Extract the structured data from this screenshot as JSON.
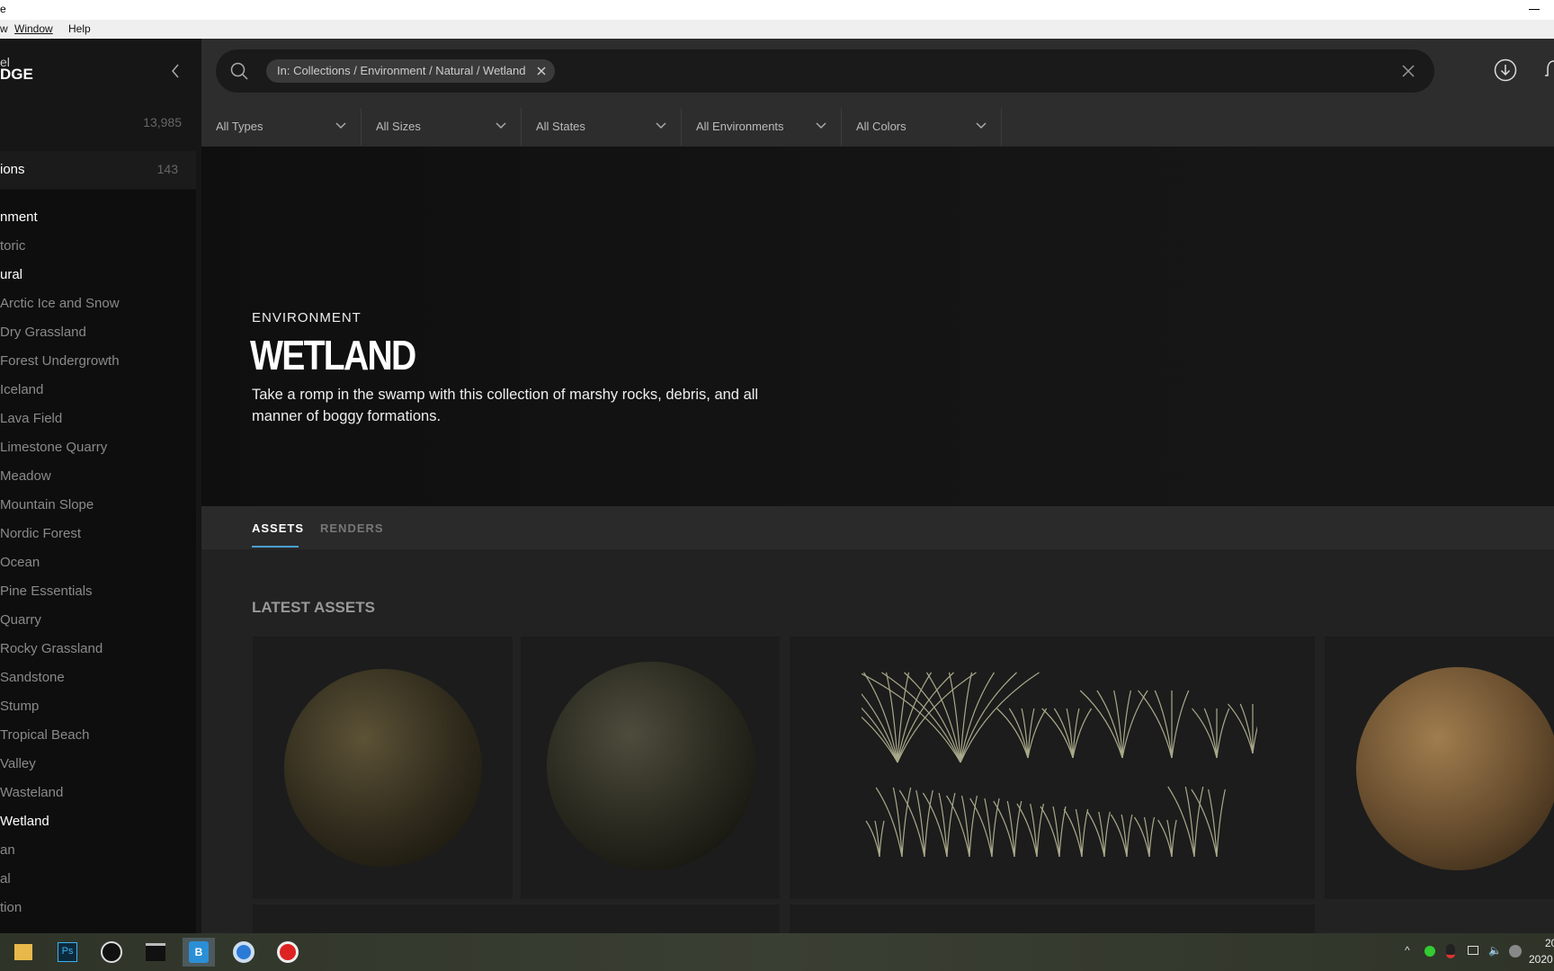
{
  "window": {
    "title_fragment": "e",
    "menu": [
      "w",
      "Window",
      "Help"
    ]
  },
  "sidebar": {
    "logo_top": "el",
    "logo_bottom": "DGE",
    "all_count": "13,985",
    "collections_label": "ions",
    "collections_count": "143",
    "items": [
      {
        "label": "nment",
        "active": true
      },
      {
        "label": "toric",
        "active": false
      },
      {
        "label": "ural",
        "active": true
      },
      {
        "label": "Arctic Ice and Snow",
        "active": false
      },
      {
        "label": "Dry Grassland",
        "active": false
      },
      {
        "label": "Forest Undergrowth",
        "active": false
      },
      {
        "label": "Iceland",
        "active": false
      },
      {
        "label": "Lava Field",
        "active": false
      },
      {
        "label": "Limestone Quarry",
        "active": false
      },
      {
        "label": "Meadow",
        "active": false
      },
      {
        "label": "Mountain Slope",
        "active": false
      },
      {
        "label": "Nordic Forest",
        "active": false
      },
      {
        "label": "Ocean",
        "active": false
      },
      {
        "label": "Pine Essentials",
        "active": false
      },
      {
        "label": "Quarry",
        "active": false
      },
      {
        "label": "Rocky Grassland",
        "active": false
      },
      {
        "label": "Sandstone",
        "active": false
      },
      {
        "label": "Stump",
        "active": false
      },
      {
        "label": "Tropical Beach",
        "active": false
      },
      {
        "label": "Valley",
        "active": false
      },
      {
        "label": "Wasteland",
        "active": false
      },
      {
        "label": "Wetland",
        "active": true
      },
      {
        "label": "an",
        "active": false
      },
      {
        "label": "al",
        "active": false
      },
      {
        "label": "tion",
        "active": false
      }
    ]
  },
  "search": {
    "chip": "In: Collections / Environment / Natural / Wetland"
  },
  "filters": [
    "All Types",
    "All Sizes",
    "All States",
    "All Environments",
    "All Colors"
  ],
  "hero": {
    "eyebrow": "ENVIRONMENT",
    "title": "WETLAND",
    "description": "Take a romp in the swamp with this collection of marshy rocks, debris, and all manner of boggy formations."
  },
  "tabs": [
    {
      "label": "ASSETS",
      "active": true
    },
    {
      "label": "RENDERS",
      "active": false
    }
  ],
  "section_title": "LATEST ASSETS",
  "accent": "#4a9fd4",
  "taskbar": {
    "apps": [
      "file-explorer",
      "photoshop",
      "unreal-engine",
      "terminal",
      "bridge",
      "browser",
      "recorder"
    ],
    "clock_time": "20",
    "clock_date": "2020"
  }
}
